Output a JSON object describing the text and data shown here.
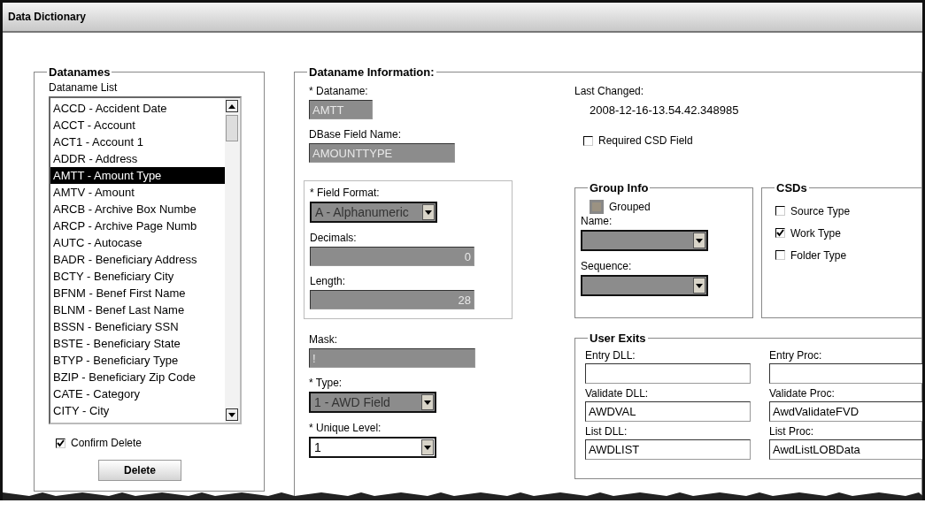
{
  "window": {
    "title": "Data Dictionary"
  },
  "datanames": {
    "legend": "Datanames",
    "list_label": "Dataname List",
    "items": [
      {
        "label": "ACCD - Accident Date",
        "selected": false
      },
      {
        "label": "ACCT - Account",
        "selected": false
      },
      {
        "label": "ACT1 - Account 1",
        "selected": false
      },
      {
        "label": "ADDR - Address",
        "selected": false
      },
      {
        "label": "AMTT - Amount Type",
        "selected": true
      },
      {
        "label": "AMTV - Amount",
        "selected": false
      },
      {
        "label": "ARCB - Archive Box Numbe",
        "selected": false
      },
      {
        "label": "ARCP - Archive Page Numb",
        "selected": false
      },
      {
        "label": "AUTC - Autocase",
        "selected": false
      },
      {
        "label": "BADR - Beneficiary Address",
        "selected": false
      },
      {
        "label": "BCTY - Beneficiary City",
        "selected": false
      },
      {
        "label": "BFNM - Benef First Name",
        "selected": false
      },
      {
        "label": "BLNM - Benef Last Name",
        "selected": false
      },
      {
        "label": "BSSN - Beneficiary SSN",
        "selected": false
      },
      {
        "label": "BSTE - Beneficiary State",
        "selected": false
      },
      {
        "label": "BTYP - Beneficiary Type",
        "selected": false
      },
      {
        "label": "BZIP - Beneficiary Zip Code",
        "selected": false
      },
      {
        "label": "CATE - Category",
        "selected": false
      },
      {
        "label": "CITY - City",
        "selected": false
      }
    ],
    "confirm_delete": {
      "label": "Confirm Delete",
      "checked": true
    },
    "delete_button": "Delete"
  },
  "info": {
    "legend": "Dataname Information:",
    "dataname": {
      "label": "* Dataname:",
      "value": "AMTT",
      "disabled": true
    },
    "dbase_field_name": {
      "label": "DBase Field Name:",
      "value": "AMOUNTTYPE",
      "disabled": true
    },
    "field_format": {
      "label": "* Field Format:",
      "value": "A - Alphanumeric",
      "disabled": true
    },
    "decimals": {
      "label": "Decimals:",
      "value": "0",
      "disabled": true
    },
    "length": {
      "label": "Length:",
      "value": "28",
      "disabled": true
    },
    "mask": {
      "label": "Mask:",
      "value": "!",
      "disabled": true
    },
    "type": {
      "label": "* Type:",
      "value": "1 - AWD Field",
      "disabled": true
    },
    "unique_level": {
      "label": "* Unique Level:",
      "value": "1",
      "disabled": false
    },
    "last_changed": {
      "label": "Last Changed:",
      "value": "2008-12-16-13.54.42.348985"
    },
    "required_csd": {
      "label": "Required CSD Field",
      "checked": false
    },
    "group_info": {
      "legend": "Group Info",
      "grouped": {
        "label": "Grouped",
        "checked": false,
        "disabled": true
      },
      "name": {
        "label": "Name:",
        "disabled": true
      },
      "sequence": {
        "label": "Sequence:",
        "disabled": true
      }
    },
    "csds": {
      "legend": "CSDs",
      "items": [
        {
          "label": "Source Type",
          "checked": false
        },
        {
          "label": "Work Type",
          "checked": true
        },
        {
          "label": "Folder Type",
          "checked": false
        }
      ]
    },
    "user_exits": {
      "legend": "User Exits",
      "fields": [
        {
          "label": "Entry DLL:"
        },
        {
          "label": "Entry Proc:"
        },
        {
          "label": "Validate DLL:",
          "value": "AWDVAL"
        },
        {
          "label": "Validate Proc:",
          "value": "AwdValidateFVD"
        },
        {
          "label": "List DLL:",
          "value": "AWDLIST"
        },
        {
          "label": "List Proc:",
          "value": "AwdListLOBData"
        }
      ]
    }
  }
}
